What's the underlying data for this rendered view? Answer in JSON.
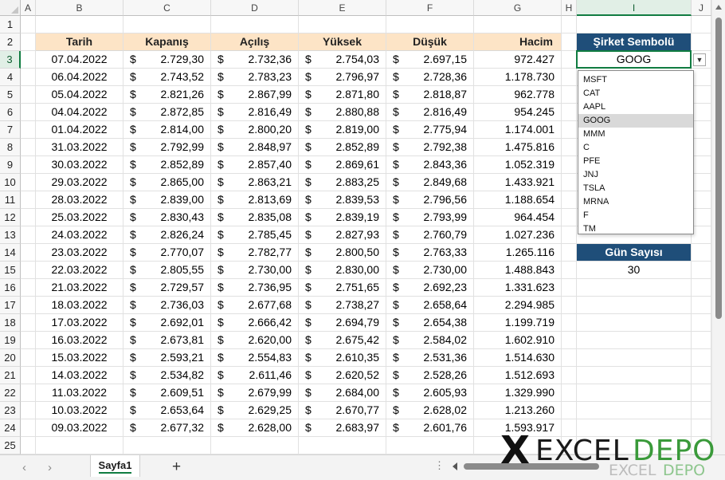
{
  "columns": [
    "A",
    "B",
    "C",
    "D",
    "E",
    "F",
    "G",
    "H",
    "I",
    "J"
  ],
  "selected_column": "I",
  "selected_row": "3",
  "table": {
    "headers": [
      "Tarih",
      "Kapanış",
      "Açılış",
      "Yüksek",
      "Düşük",
      "Hacim"
    ],
    "currency_symbol": "$",
    "rows": [
      [
        "07.04.2022",
        "2.729,30",
        "2.732,36",
        "2.754,03",
        "2.697,15",
        "972.427"
      ],
      [
        "06.04.2022",
        "2.743,52",
        "2.783,23",
        "2.796,97",
        "2.728,36",
        "1.178.730"
      ],
      [
        "05.04.2022",
        "2.821,26",
        "2.867,99",
        "2.871,80",
        "2.818,87",
        "962.778"
      ],
      [
        "04.04.2022",
        "2.872,85",
        "2.816,49",
        "2.880,88",
        "2.816,49",
        "954.245"
      ],
      [
        "01.04.2022",
        "2.814,00",
        "2.800,20",
        "2.819,00",
        "2.775,94",
        "1.174.001"
      ],
      [
        "31.03.2022",
        "2.792,99",
        "2.848,97",
        "2.852,89",
        "2.792,38",
        "1.475.816"
      ],
      [
        "30.03.2022",
        "2.852,89",
        "2.857,40",
        "2.869,61",
        "2.843,36",
        "1.052.319"
      ],
      [
        "29.03.2022",
        "2.865,00",
        "2.863,21",
        "2.883,25",
        "2.849,68",
        "1.433.921"
      ],
      [
        "28.03.2022",
        "2.839,00",
        "2.813,69",
        "2.839,53",
        "2.796,56",
        "1.188.654"
      ],
      [
        "25.03.2022",
        "2.830,43",
        "2.835,08",
        "2.839,19",
        "2.793,99",
        "964.454"
      ],
      [
        "24.03.2022",
        "2.826,24",
        "2.785,45",
        "2.827,93",
        "2.760,79",
        "1.027.236"
      ],
      [
        "23.03.2022",
        "2.770,07",
        "2.782,77",
        "2.800,50",
        "2.763,33",
        "1.265.116"
      ],
      [
        "22.03.2022",
        "2.805,55",
        "2.730,00",
        "2.830,00",
        "2.730,00",
        "1.488.843"
      ],
      [
        "21.03.2022",
        "2.729,57",
        "2.736,95",
        "2.751,65",
        "2.692,23",
        "1.331.623"
      ],
      [
        "18.03.2022",
        "2.736,03",
        "2.677,68",
        "2.738,27",
        "2.658,64",
        "2.294.985"
      ],
      [
        "17.03.2022",
        "2.692,01",
        "2.666,42",
        "2.694,79",
        "2.654,38",
        "1.199.719"
      ],
      [
        "16.03.2022",
        "2.673,81",
        "2.620,00",
        "2.675,42",
        "2.584,02",
        "1.602.910"
      ],
      [
        "15.03.2022",
        "2.593,21",
        "2.554,83",
        "2.610,35",
        "2.531,36",
        "1.514.630"
      ],
      [
        "14.03.2022",
        "2.534,82",
        "2.611,46",
        "2.620,52",
        "2.528,26",
        "1.512.693"
      ],
      [
        "11.03.2022",
        "2.609,51",
        "2.679,99",
        "2.684,00",
        "2.605,93",
        "1.329.990"
      ],
      [
        "10.03.2022",
        "2.653,64",
        "2.629,25",
        "2.670,77",
        "2.628,02",
        "1.213.260"
      ],
      [
        "09.03.2022",
        "2.677,32",
        "2.628,00",
        "2.683,97",
        "2.601,76",
        "1.593.917"
      ]
    ]
  },
  "symbol_panel": {
    "label": "Şirket Sembolü",
    "value": "GOOG",
    "options": [
      "MSFT",
      "CAT",
      "AAPL",
      "GOOG",
      "MMM",
      "C",
      "PFE",
      "JNJ",
      "TSLA",
      "MRNA",
      "F",
      "TM"
    ],
    "highlighted": "GOOG"
  },
  "days_panel": {
    "label": "Gün Sayısı",
    "value": "30"
  },
  "sheet_tabs": [
    {
      "name": "Sayfa1",
      "active": true
    }
  ],
  "icons": {
    "prev_sheet": "chevron-left-icon",
    "next_sheet": "chevron-right-icon",
    "add_sheet": "plus-icon",
    "dropdown": "chevron-down-icon",
    "options": "vertical-dots-icon"
  },
  "logo": {
    "main_left": "EXCEL",
    "main_right": "DEPO",
    "sub_left": "EXCEL",
    "sub_right": "DEPO"
  },
  "colors": {
    "header_fill": "#fde4c6",
    "panel_fill": "#1f4e79",
    "accent_green": "#107c41",
    "logo_green": "#3a9a3a"
  }
}
